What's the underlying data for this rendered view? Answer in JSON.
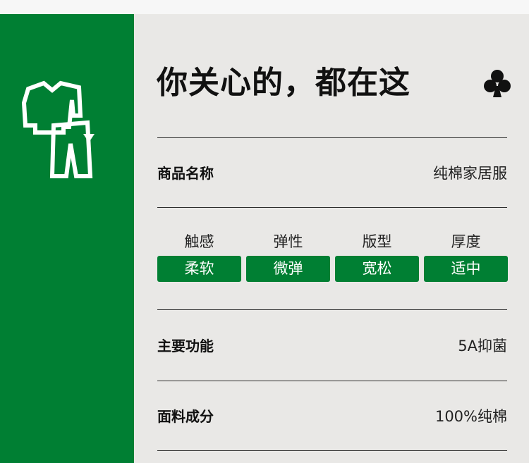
{
  "header": {
    "title": "你关心的，都在这",
    "icon": "club-icon"
  },
  "sidebar": {
    "icon": "clothing-icon",
    "background": "#007f33"
  },
  "product_name": {
    "label": "商品名称",
    "value": "纯棉家居服"
  },
  "attributes": [
    {
      "name": "触感",
      "value": "柔软"
    },
    {
      "name": "弹性",
      "value": "微弹"
    },
    {
      "name": "版型",
      "value": "宽松"
    },
    {
      "name": "厚度",
      "value": "适中"
    }
  ],
  "main_function": {
    "label": "主要功能",
    "value": "5A抑菌"
  },
  "material": {
    "label": "面料成分",
    "value": "100%纯棉"
  },
  "colors": {
    "accent": "#007f33",
    "panel": "#e9e8e6",
    "text": "#111111"
  }
}
